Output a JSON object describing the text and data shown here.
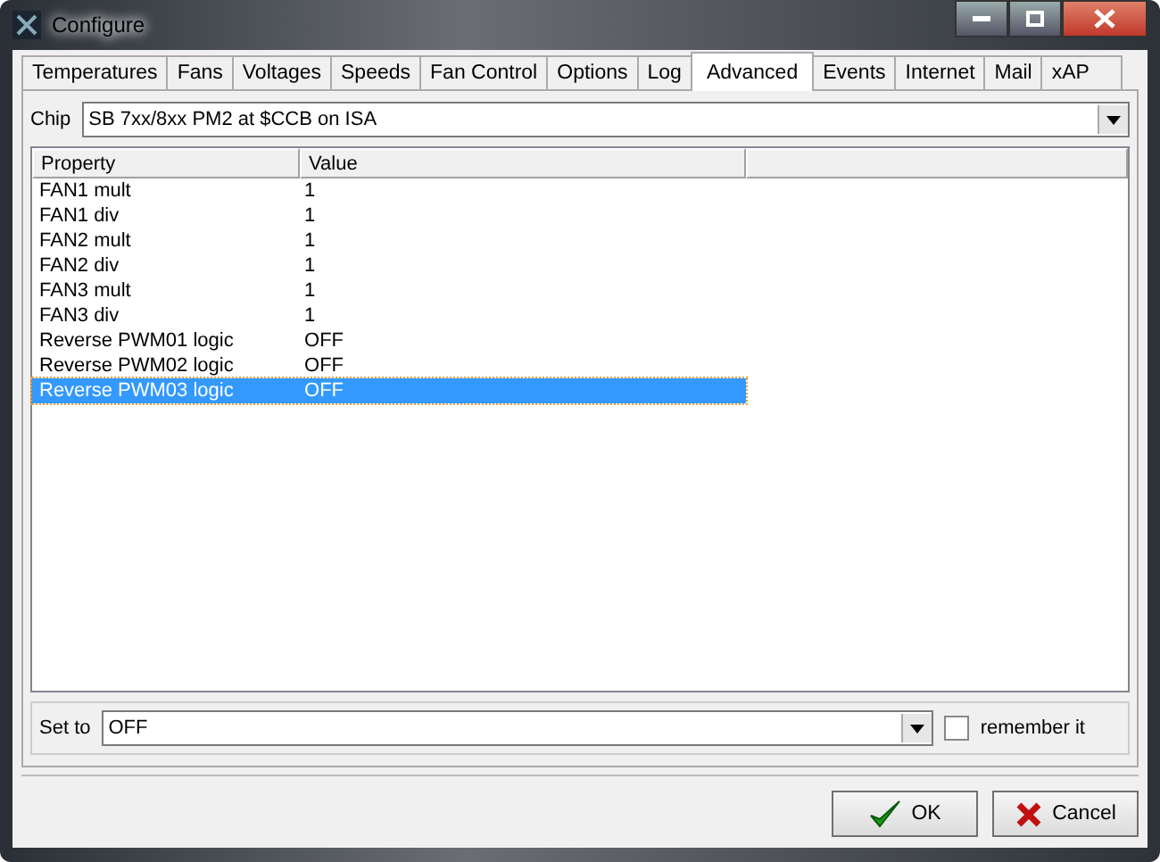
{
  "window": {
    "title": "Configure"
  },
  "tabs": [
    {
      "label": "Temperatures",
      "selected": false
    },
    {
      "label": "Fans",
      "selected": false
    },
    {
      "label": "Voltages",
      "selected": false
    },
    {
      "label": "Speeds",
      "selected": false
    },
    {
      "label": "Fan Control",
      "selected": false
    },
    {
      "label": "Options",
      "selected": false
    },
    {
      "label": "Log",
      "selected": false
    },
    {
      "label": "Advanced",
      "selected": true
    },
    {
      "label": "Events",
      "selected": false
    },
    {
      "label": "Internet",
      "selected": false
    },
    {
      "label": "Mail",
      "selected": false
    },
    {
      "label": "xAP",
      "selected": false
    }
  ],
  "chip": {
    "label": "Chip",
    "value": "SB 7xx/8xx PM2 at $CCB on ISA"
  },
  "table": {
    "columns": [
      "Property",
      "Value"
    ],
    "rows": [
      {
        "property": "FAN1 mult",
        "value": "1",
        "selected": false
      },
      {
        "property": "FAN1 div",
        "value": "1",
        "selected": false
      },
      {
        "property": "FAN2 mult",
        "value": "1",
        "selected": false
      },
      {
        "property": "FAN2 div",
        "value": "1",
        "selected": false
      },
      {
        "property": "FAN3 mult",
        "value": "1",
        "selected": false
      },
      {
        "property": "FAN3 div",
        "value": "1",
        "selected": false
      },
      {
        "property": "Reverse PWM01 logic",
        "value": "OFF",
        "selected": false
      },
      {
        "property": "Reverse PWM02 logic",
        "value": "OFF",
        "selected": false
      },
      {
        "property": "Reverse PWM03 logic",
        "value": "OFF",
        "selected": true
      }
    ]
  },
  "set_to": {
    "label": "Set to",
    "value": "OFF",
    "remember": {
      "label": "remember it",
      "checked": false
    }
  },
  "buttons": [
    {
      "kind": "ok",
      "label": "OK"
    },
    {
      "kind": "cancel",
      "label": "Cancel"
    }
  ]
}
